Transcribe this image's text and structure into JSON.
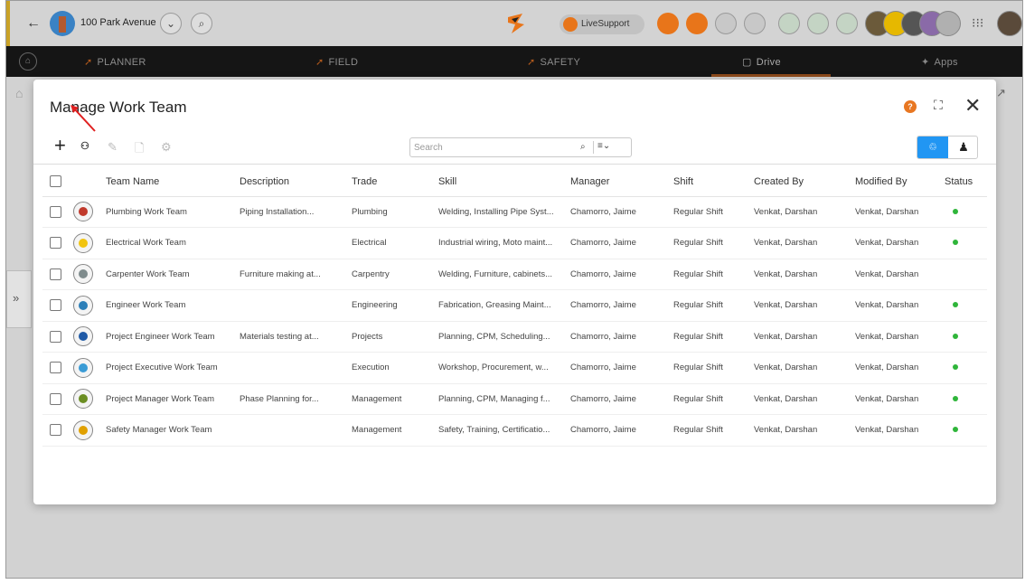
{
  "topbar": {
    "back_icon": "back-arrow-icon",
    "project_name": "100 Park Avenue",
    "livesupport_label": "LiveSupport"
  },
  "nav": {
    "items": [
      {
        "label": "PLANNER"
      },
      {
        "label": "FIELD"
      },
      {
        "label": "SAFETY"
      },
      {
        "label": "Drive"
      },
      {
        "label": "Apps"
      }
    ]
  },
  "modal": {
    "title": "Manage Work Team",
    "search_placeholder": "Search",
    "columns": [
      "Team Name",
      "Description",
      "Trade",
      "Skill",
      "Manager",
      "Shift",
      "Created By",
      "Modified By",
      "Status"
    ],
    "rows": [
      {
        "team": "Plumbing Work Team",
        "description": "Piping Installation...",
        "trade": "Plumbing",
        "skill": "Welding, Installing Pipe Syst...",
        "manager": "Chamorro, Jaime",
        "shift": "Regular Shift",
        "created_by": "Venkat, Darshan",
        "modified_by": "Venkat, Darshan",
        "active": true
      },
      {
        "team": "Electrical Work Team",
        "description": "",
        "trade": "Electrical",
        "skill": "Industrial wiring, Moto maint...",
        "manager": "Chamorro, Jaime",
        "shift": "Regular Shift",
        "created_by": "Venkat, Darshan",
        "modified_by": "Venkat, Darshan",
        "active": true
      },
      {
        "team": "Carpenter Work Team",
        "description": "Furniture making at...",
        "trade": "Carpentry",
        "skill": "Welding, Furniture, cabinets...",
        "manager": "Chamorro, Jaime",
        "shift": "Regular Shift",
        "created_by": "Venkat, Darshan",
        "modified_by": "Venkat, Darshan",
        "active": false
      },
      {
        "team": "Engineer Work Team",
        "description": "",
        "trade": "Engineering",
        "skill": "Fabrication, Greasing Maint...",
        "manager": "Chamorro, Jaime",
        "shift": "Regular Shift",
        "created_by": "Venkat, Darshan",
        "modified_by": "Venkat, Darshan",
        "active": true
      },
      {
        "team": "Project Engineer Work Team",
        "description": "Materials testing at...",
        "trade": "Projects",
        "skill": "Planning, CPM, Scheduling...",
        "manager": "Chamorro, Jaime",
        "shift": "Regular Shift",
        "created_by": "Venkat, Darshan",
        "modified_by": "Venkat, Darshan",
        "active": true
      },
      {
        "team": "Project Executive Work Team",
        "description": "",
        "trade": "Execution",
        "skill": "Workshop, Procurement, w...",
        "manager": "Chamorro, Jaime",
        "shift": "Regular Shift",
        "created_by": "Venkat, Darshan",
        "modified_by": "Venkat, Darshan",
        "active": true
      },
      {
        "team": "Project Manager Work Team",
        "description": "Phase Planning for...",
        "trade": "Management",
        "skill": "Planning, CPM, Managing f...",
        "manager": "Chamorro, Jaime",
        "shift": "Regular Shift",
        "created_by": "Venkat, Darshan",
        "modified_by": "Venkat, Darshan",
        "active": true
      },
      {
        "team": "Safety Manager Work Team",
        "description": "",
        "trade": "Management",
        "skill": "Safety, Training, Certificatio...",
        "manager": "Chamorro, Jaime",
        "shift": "Regular Shift",
        "created_by": "Venkat, Darshan",
        "modified_by": "Venkat, Darshan",
        "active": true
      }
    ]
  },
  "colors": {
    "accent": "#2196f3",
    "status_active": "#2fb53a",
    "help": "#e87722",
    "nav_icon": "#b35a1c",
    "annotation_arrow": "#e02020"
  }
}
